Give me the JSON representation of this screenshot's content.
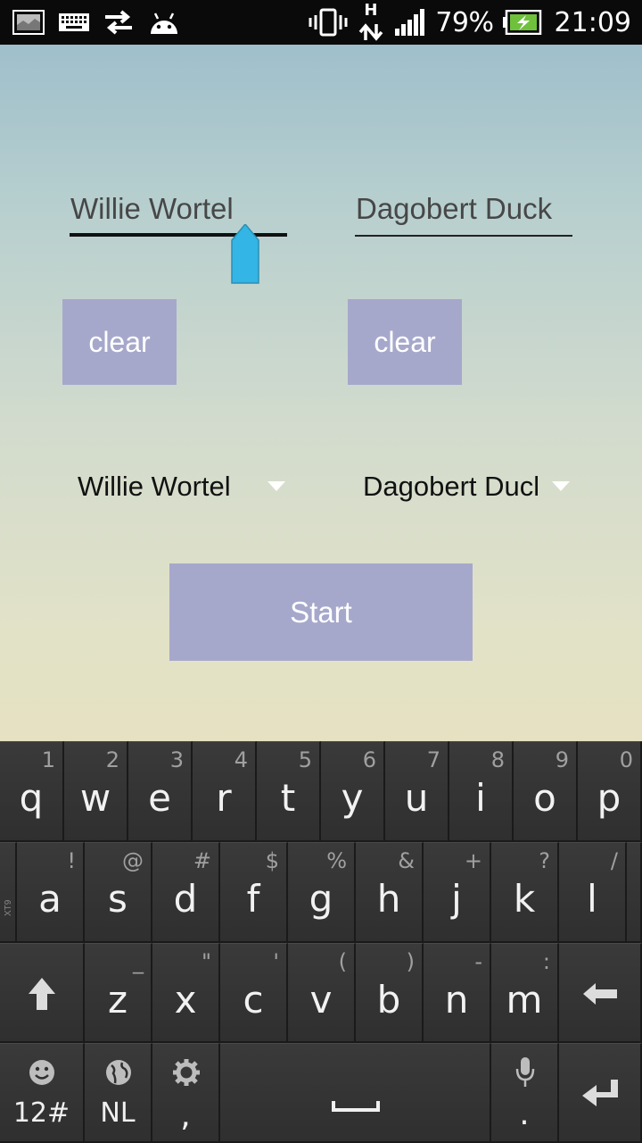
{
  "status_bar": {
    "battery": "79%",
    "time": "21:09",
    "network": "H",
    "icons_left": [
      "screenshot-icon",
      "keyboard-icon",
      "data-sync-icon",
      "android-icon"
    ],
    "icons_right": [
      "vibrate-icon",
      "network-h-icon",
      "signal-icon",
      "battery-charging-icon"
    ]
  },
  "form": {
    "player1": {
      "value": "Willie Wortel",
      "clear_label": "clear"
    },
    "player2": {
      "value": "Dagobert Duck",
      "clear_label": "clear"
    },
    "spinner1": {
      "selected": "Willie Wortel"
    },
    "spinner2": {
      "selected": "Dagobert Duck"
    },
    "start_label": "Start"
  },
  "colors": {
    "button_bg": "#a6a8cb",
    "handle": "#33b5e5"
  },
  "keyboard": {
    "row1": [
      {
        "key": "q",
        "hint": "1"
      },
      {
        "key": "w",
        "hint": "2"
      },
      {
        "key": "e",
        "hint": "3"
      },
      {
        "key": "r",
        "hint": "4"
      },
      {
        "key": "t",
        "hint": "5"
      },
      {
        "key": "y",
        "hint": "6"
      },
      {
        "key": "u",
        "hint": "7"
      },
      {
        "key": "i",
        "hint": "8"
      },
      {
        "key": "o",
        "hint": "9"
      },
      {
        "key": "p",
        "hint": "0"
      }
    ],
    "row2": [
      {
        "key": "a",
        "hint": "!"
      },
      {
        "key": "s",
        "hint": "@"
      },
      {
        "key": "d",
        "hint": "#"
      },
      {
        "key": "f",
        "hint": "$"
      },
      {
        "key": "g",
        "hint": "%"
      },
      {
        "key": "h",
        "hint": "&"
      },
      {
        "key": "j",
        "hint": "+"
      },
      {
        "key": "k",
        "hint": "?"
      },
      {
        "key": "l",
        "hint": "/"
      }
    ],
    "row3": [
      {
        "key": "z",
        "hint": "_"
      },
      {
        "key": "x",
        "hint": "\""
      },
      {
        "key": "c",
        "hint": "'"
      },
      {
        "key": "v",
        "hint": "("
      },
      {
        "key": "b",
        "hint": ")"
      },
      {
        "key": "n",
        "hint": "-"
      },
      {
        "key": "m",
        "hint": ":"
      }
    ],
    "symbols_label": "12#",
    "language_label": "NL",
    "comma_label": ",",
    "period_label": ".",
    "side_tag": "XT9"
  }
}
